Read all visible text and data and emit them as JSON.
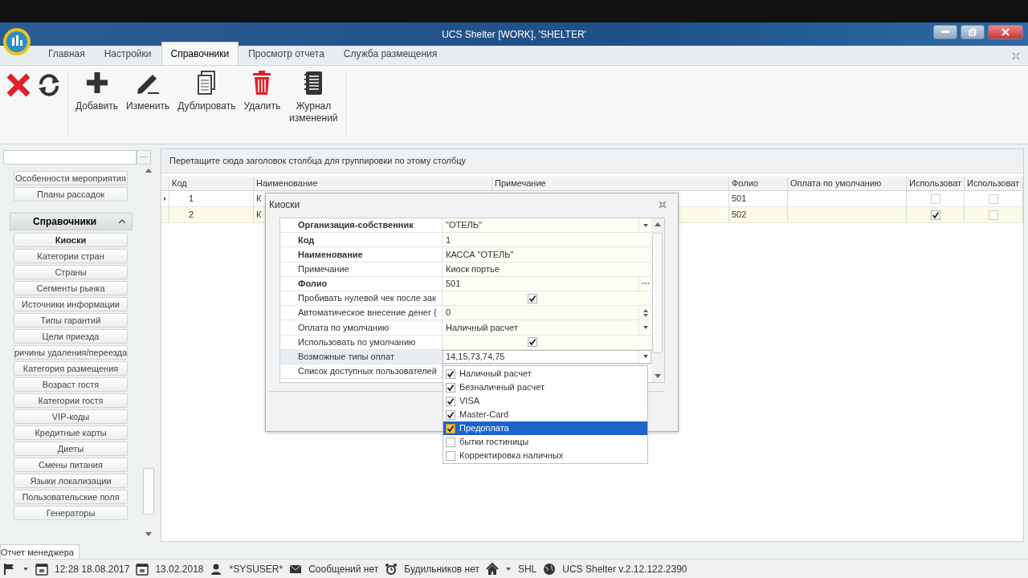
{
  "window": {
    "title": "UCS Shelter [WORK], 'SHELTER'"
  },
  "tabs": [
    {
      "label": "Главная",
      "selected": false
    },
    {
      "label": "Настройки",
      "selected": false
    },
    {
      "label": "Справочники",
      "selected": true
    },
    {
      "label": "Просмотр отчета",
      "selected": false
    },
    {
      "label": "Служба размещения",
      "selected": false
    }
  ],
  "toolbar": [
    {
      "kind": "close"
    },
    {
      "kind": "refresh"
    },
    {
      "kind": "add",
      "label": "Добавить"
    },
    {
      "kind": "edit",
      "label": "Изменить"
    },
    {
      "kind": "duplicate",
      "label": "Дублировать"
    },
    {
      "kind": "delete",
      "label": "Удалить"
    },
    {
      "kind": "journal",
      "label": "Журнал изменений"
    }
  ],
  "sidebar": {
    "search_button": "···",
    "top_items": [
      {
        "label": "Особенности мероприятия",
        "selected": false
      },
      {
        "label": "Планы рассадок",
        "selected": false
      }
    ],
    "section": {
      "title": "Справочники",
      "expanded": true,
      "items": [
        {
          "label": "Киоски",
          "selected": true
        },
        {
          "label": "Категории стран",
          "selected": false
        },
        {
          "label": "Страны",
          "selected": false
        },
        {
          "label": "Сегменты рынка",
          "selected": false
        },
        {
          "label": "Источники информации",
          "selected": false
        },
        {
          "label": "Типы гарантий",
          "selected": false
        },
        {
          "label": "Цели приезда",
          "selected": false
        },
        {
          "label": "ричины удаления/переезда",
          "selected": false
        },
        {
          "label": "Категория размещения",
          "selected": false
        },
        {
          "label": "Возраст гостя",
          "selected": false
        },
        {
          "label": "Категории гостя",
          "selected": false
        },
        {
          "label": "VIP-коды",
          "selected": false
        },
        {
          "label": "Кредитные карты",
          "selected": false
        },
        {
          "label": "Диеты",
          "selected": false
        },
        {
          "label": "Смены питания",
          "selected": false
        },
        {
          "label": "Языки локализации",
          "selected": false
        },
        {
          "label": "Пользовательские поля",
          "selected": false
        },
        {
          "label": "Генераторы",
          "selected": false
        }
      ]
    }
  },
  "grid": {
    "group_hint": "Перетащите сюда заголовок столбца для группировки по этому столбцу",
    "columns": [
      "Код",
      "Наименование",
      "Примечание",
      "Фолио",
      "Оплата по умолчанию",
      "Использоват",
      "Использоват"
    ],
    "rows": [
      {
        "current": true,
        "selected": false,
        "code": "1",
        "name": "К",
        "folio": "501",
        "use_1": false,
        "use_2": false
      },
      {
        "current": false,
        "selected": true,
        "code": "2",
        "name": "К",
        "folio": "502",
        "use_1": true,
        "use_2": false
      }
    ]
  },
  "dialog": {
    "title": "Киоски",
    "properties": [
      {
        "label": "Организация-собственник",
        "bold": true,
        "kind": "dropdown",
        "value": "\"ОТЕЛЬ\"",
        "selected": false
      },
      {
        "label": "Код",
        "bold": true,
        "kind": "text",
        "value": "1",
        "selected": false
      },
      {
        "label": "Наименование",
        "bold": true,
        "kind": "text",
        "value": "КАССА \"ОТЕЛЬ\"",
        "selected": false
      },
      {
        "label": "Примечание",
        "bold": false,
        "kind": "text",
        "value": "Киоск портье",
        "selected": false
      },
      {
        "label": "Фолио",
        "bold": true,
        "kind": "ellipsis",
        "value": "501",
        "selected": false
      },
      {
        "label": "Пробивать нулевой чек после зак",
        "bold": false,
        "kind": "checkbox",
        "checked": true,
        "selected": false
      },
      {
        "label": "Автоматическое внесение денег (",
        "bold": false,
        "kind": "spin",
        "value": "0",
        "selected": false
      },
      {
        "label": "Оплата по умолчанию",
        "bold": false,
        "kind": "dropdown",
        "value": "Наличный расчет",
        "selected": false
      },
      {
        "label": "Использовать по умолчанию",
        "bold": false,
        "kind": "checkbox",
        "checked": true,
        "selected": false
      },
      {
        "label": "Возможные типы оплат",
        "bold": false,
        "kind": "dropdown",
        "value": "14,15,73,74,75",
        "selected": true
      },
      {
        "label": "Список доступных пользователей",
        "bold": false,
        "kind": "text",
        "selected": false
      }
    ]
  },
  "dropdown": {
    "items": [
      {
        "label": "Наличный расчет",
        "checked": true,
        "selected": false
      },
      {
        "label": "Безналичный расчет",
        "checked": true,
        "selected": false
      },
      {
        "label": "VISA",
        "checked": true,
        "selected": false
      },
      {
        "label": "Master-Card",
        "checked": true,
        "selected": false
      },
      {
        "label": "Предоплата",
        "checked": true,
        "selected": true
      },
      {
        "label": "бытки гостиницы",
        "checked": false,
        "selected": false
      },
      {
        "label": "Корректировка наличных",
        "checked": false,
        "selected": false
      }
    ]
  },
  "bottom_tab": "Отчет менеджера",
  "status_bar": [
    {
      "kind": "flag",
      "caret": true
    },
    {
      "kind": "calendar",
      "text": "12:28 18.08.2017"
    },
    {
      "kind": "calendar",
      "text": "13.02.2018"
    },
    {
      "kind": "user",
      "text": "*SYSUSER*"
    },
    {
      "kind": "mail",
      "text": "Сообщений нет"
    },
    {
      "kind": "alarm",
      "text": "Будильников нет"
    },
    {
      "kind": "home",
      "caret": true,
      "text": "SHL"
    },
    {
      "kind": "globe",
      "text": "UCS Shelter v.2.12.122.2390"
    }
  ]
}
